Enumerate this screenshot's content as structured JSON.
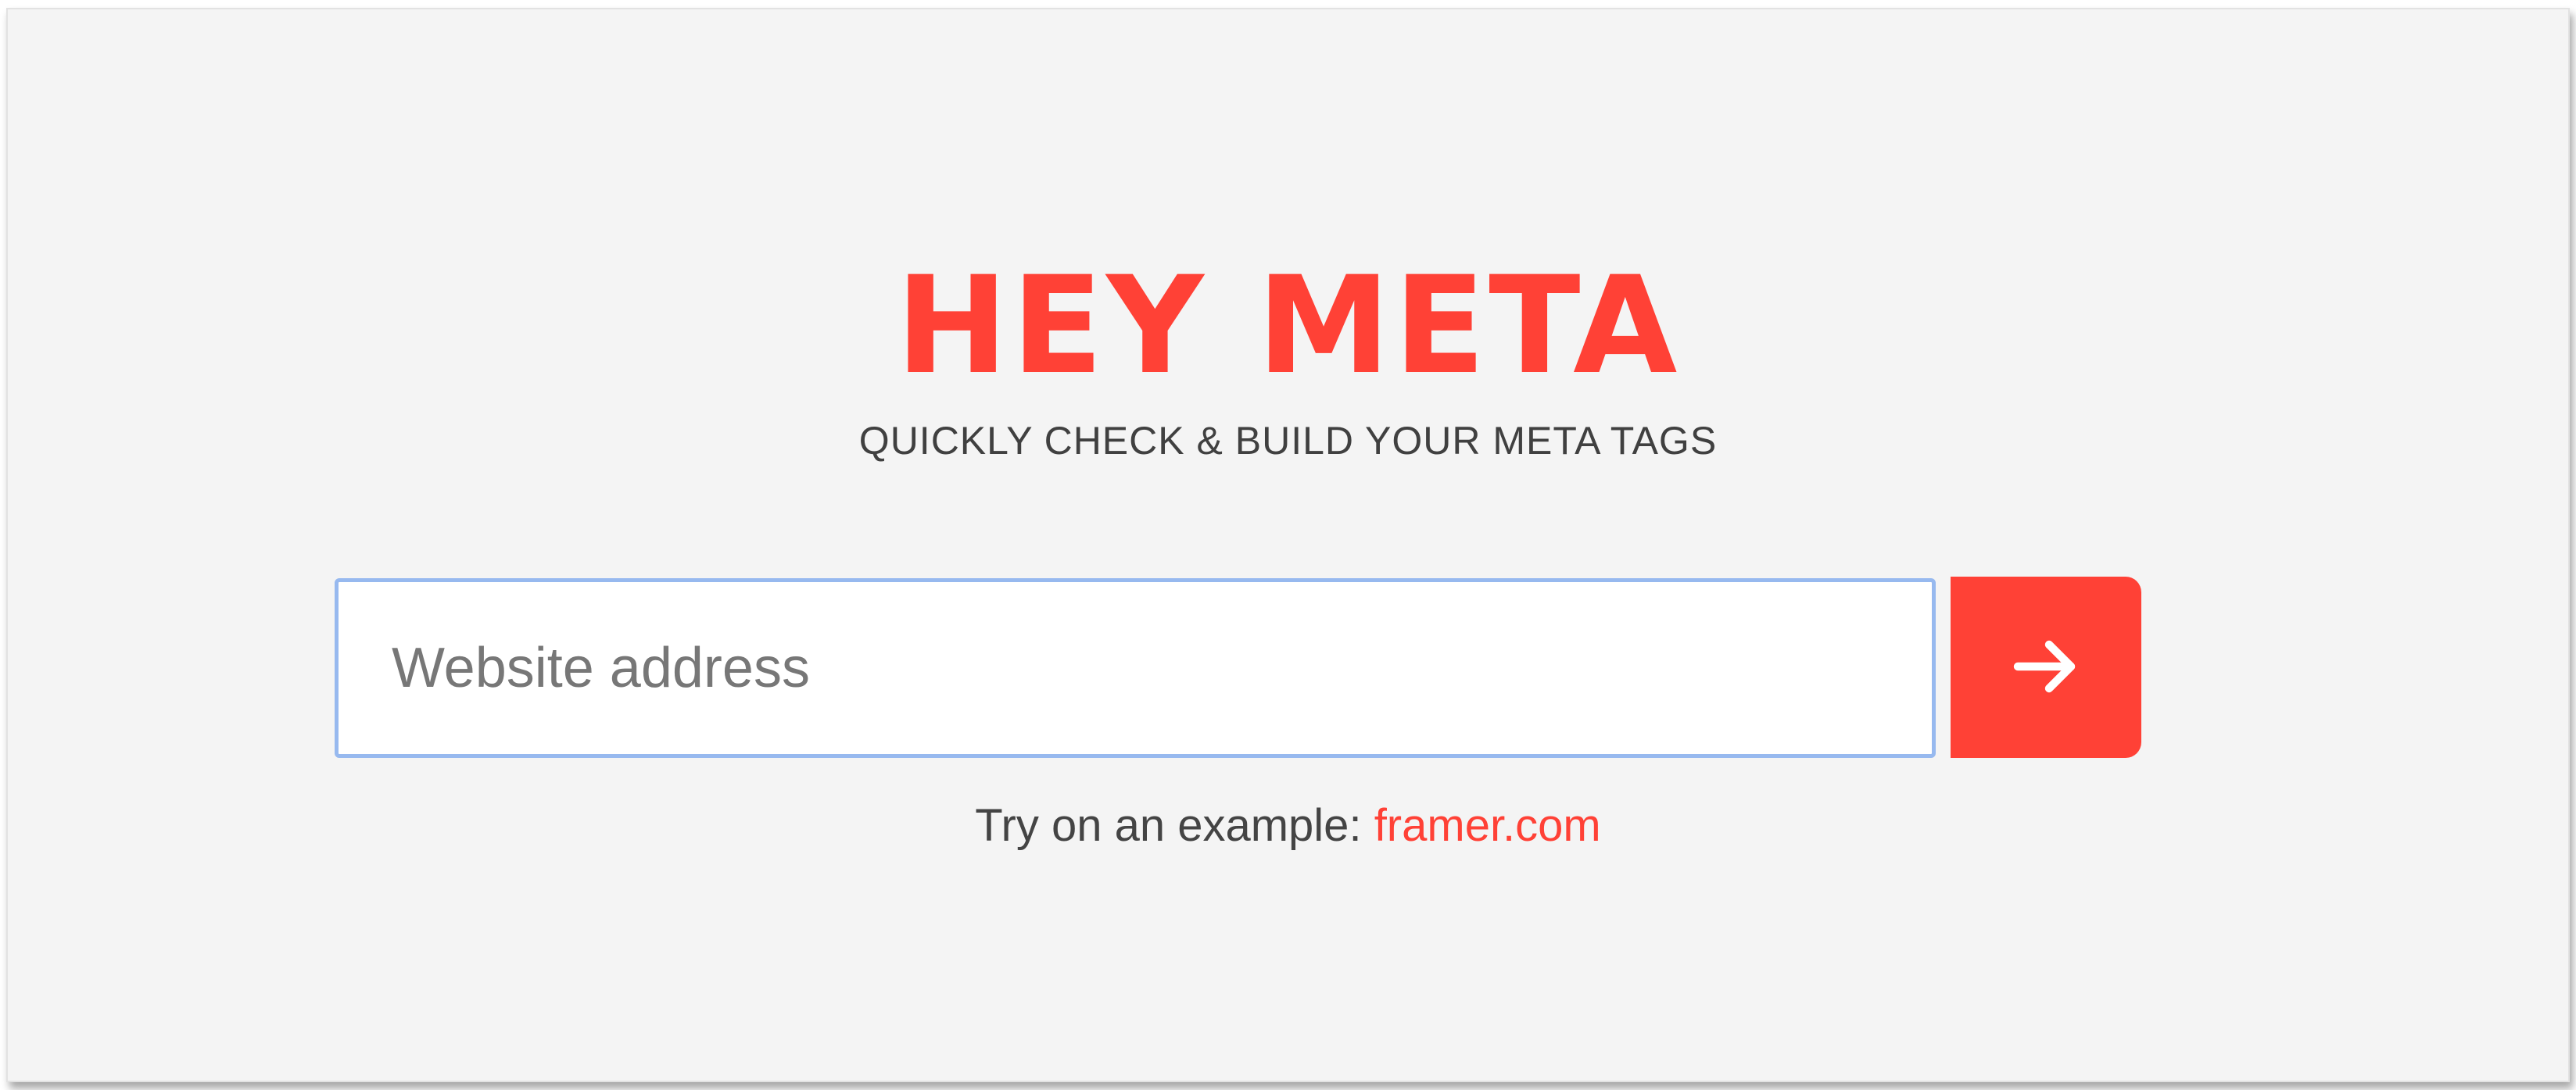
{
  "brand": {
    "logo_text": "HEY META",
    "tagline": "QUICKLY CHECK & BUILD YOUR META TAGS",
    "accent_color": "#ff4136"
  },
  "search": {
    "value": "",
    "placeholder": "Website address",
    "submit_icon": "arrow-right-icon"
  },
  "example": {
    "prompt": "Try on an example:",
    "link_text": "framer.com"
  }
}
